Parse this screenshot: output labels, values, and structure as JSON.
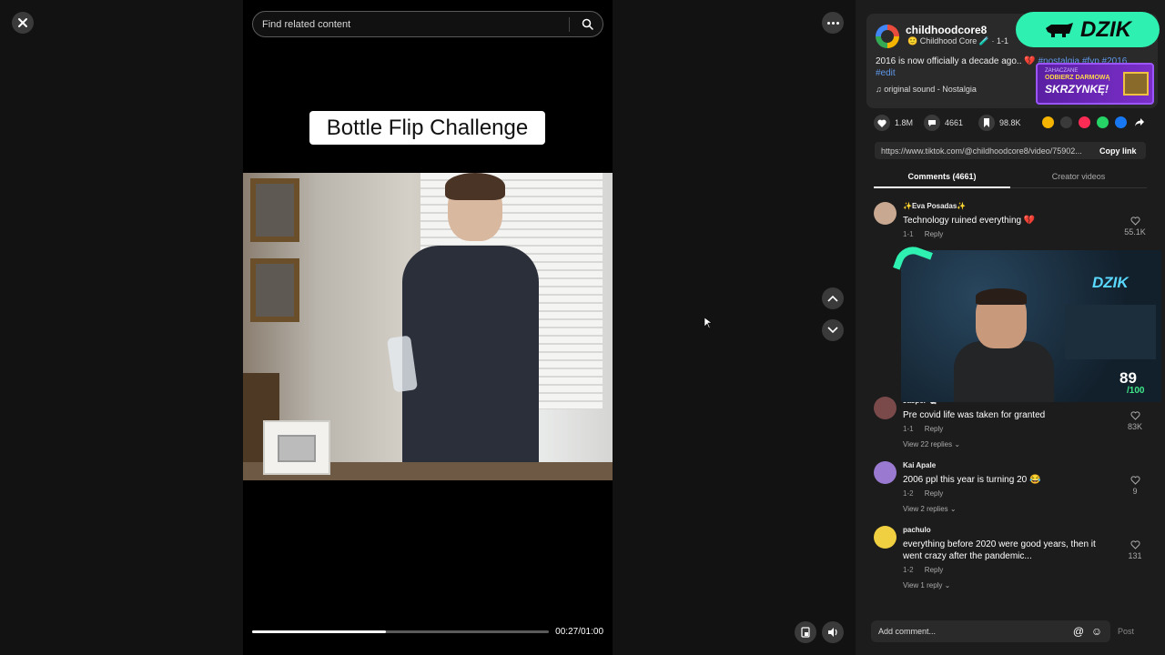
{
  "player": {
    "close_icon": "close-icon",
    "search": {
      "placeholder": "Find related content"
    },
    "video_title": "Bottle Flip Challenge",
    "progress": 0.45,
    "time": "00:27/01:00"
  },
  "creator": {
    "handle": "childhoodcore8",
    "subtitle": "Childhood Core",
    "subtitle_date": "· 1-1",
    "description_text": "2016 is now officially a decade ago..",
    "description_emoji": "💔",
    "hashtags": "#nostalgia #fyp #2016",
    "hashtag_edit": "#edit",
    "sound": "original sound - Nostalgia"
  },
  "overlay": {
    "dzik_badge": "DZIK",
    "promo_top": "ZAHACZANE",
    "promo_mid": "ODBIERZ DARMOWĄ",
    "promo_main": "SKRZYNKĘ!"
  },
  "actions": {
    "likes": "1.8M",
    "comments": "4661",
    "saves": "98.8K"
  },
  "share_colors": [
    "#f4b400",
    "#3a3a3a",
    "#fe2c55",
    "#25d366",
    "#1877f2"
  ],
  "link": {
    "url": "https://www.tiktok.com/@childhoodcore8/video/75902...",
    "copy_label": "Copy link"
  },
  "tabs": {
    "comments": "Comments (4661)",
    "creator_videos": "Creator videos"
  },
  "comments": [
    {
      "name": "✨Eva Posadas✨",
      "text": "Technology ruined everything 💔",
      "date": "1-1",
      "reply": "Reply",
      "likes": "55.1K",
      "avatar_color": "#c8a890"
    },
    {
      "name": "Jasper 🐚",
      "text": "Pre covid life was taken for granted",
      "date": "1-1",
      "reply": "Reply",
      "likes": "83K",
      "view_replies": "View 22 replies",
      "avatar_color": "#7a4a4a"
    },
    {
      "name": "Kai Apale",
      "text": "2006 ppl this year is turning 20 😂",
      "date": "1-2",
      "reply": "Reply",
      "likes": "9",
      "view_replies": "View 2 replies",
      "avatar_color": "#9a7ad0"
    },
    {
      "name": "pachulo",
      "text": "everything before 2020 were good years, then it went crazy after the pandemic...",
      "date": "1-2",
      "reply": "Reply",
      "likes": "131",
      "view_replies": "View 1 reply",
      "avatar_color": "#f0d040"
    }
  ],
  "stream": {
    "score": "89",
    "score_total": "/100",
    "neon": "DZIK"
  },
  "comment_input": {
    "placeholder": "Add comment...",
    "post": "Post"
  }
}
